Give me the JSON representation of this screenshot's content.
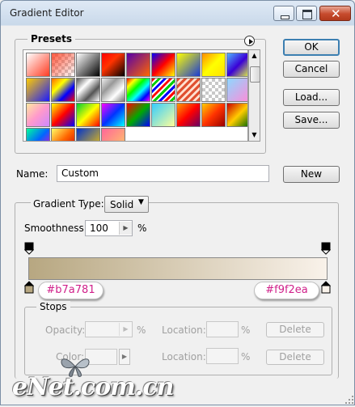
{
  "window": {
    "title": "Gradient Editor",
    "controls": {
      "minimize": "minimize-icon",
      "maximize": "maximize-icon",
      "close": "close-icon"
    }
  },
  "presets": {
    "label": "Presets",
    "menu_icon": "triangle-right-icon",
    "swatches": [
      "linear-gradient(135deg,#ffffff,#ff3b22)",
      "checker-red",
      "linear-gradient(135deg,#ffffff,#000000)",
      "linear-gradient(135deg,#ff0000,#ff3300 40%,#000 100%)",
      "linear-gradient(135deg,#5500aa,#ff6600)",
      "linear-gradient(135deg,#0000ff,#ff0000,#ffff00)",
      "linear-gradient(135deg,#ffff00,#1a3bd6)",
      "linear-gradient(135deg,#ff8c00,#ffff00 50%,#ffe100)",
      "linear-gradient(135deg,#4fb2ff,#3a00d6,#e8ff3a)",
      "linear-gradient(135deg,#ffcc00,#1a1aff)",
      "linear-gradient(135deg,#ff6600,#ffff00,#0000ff,#ff0000)",
      "linear-gradient(135deg,#555,#fff,#555,#fff)",
      "linear-gradient(135deg,#eee,#999,#fff,#777)",
      "linear-gradient(135deg,#ff0000,#ffff00,#00ff00,#00ffff,#0000ff,#ff00ff)",
      "stripes-rainbow",
      "stripes-red",
      "checker-gray",
      "linear-gradient(135deg,#8ed8ff,#ff8bd8)",
      "linear-gradient(135deg,#ffe8a0,#ff99cc,#cc88ff)",
      "linear-gradient(135deg,#ffff00,#ff0000,#0000ff)",
      "linear-gradient(135deg,#00cc33,#ffff00,#ff0000)",
      "linear-gradient(135deg,#ff00ff,#0033ff,#00ffff)",
      "linear-gradient(135deg,#ff0000,#00aa00,#0000ff)",
      "linear-gradient(135deg,#33ccff,#ffff99)",
      "linear-gradient(135deg,#ff9900,#ff0000,#660066)",
      "linear-gradient(135deg,#ffcc00,#ff3300,#990000)",
      "linear-gradient(135deg,#cc0000,#ffcc00,#006600)",
      "linear-gradient(135deg,#00ff99,#0066ff,#ff00cc)",
      "linear-gradient(135deg,#ffff66,#ff6600,#cc0000)",
      "linear-gradient(135deg,#0033cc,#ffcc00)",
      "linear-gradient(135deg,#ff6699,#ffcc66)"
    ]
  },
  "name": {
    "label": "Name:",
    "value": "Custom"
  },
  "buttons": {
    "ok": "OK",
    "cancel": "Cancel",
    "load": "Load...",
    "save": "Save...",
    "new": "New"
  },
  "gradient_type": {
    "label": "Gradient Type:",
    "value": "Solid"
  },
  "smoothness": {
    "label": "Smoothness:",
    "value": "100",
    "unit": "%"
  },
  "gradient": {
    "start_color": "#b7a781",
    "end_color": "#f9f2ea"
  },
  "stop_labels": {
    "left": "#b7a781",
    "right": "#f9f2ea"
  },
  "stops": {
    "label": "Stops",
    "opacity_label": "Opacity:",
    "opacity_unit": "%",
    "location_label": "Location:",
    "location_unit": "%",
    "delete": "Delete",
    "color_label": "Color:"
  },
  "watermark": {
    "text": "eNet.com.cn"
  }
}
